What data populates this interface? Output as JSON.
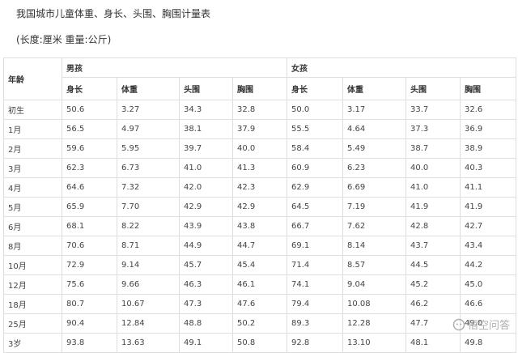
{
  "title": "我国城市儿童体重、身长、头围、胸围计量表",
  "subtitle": "(长度:厘米 重量:公斤)",
  "table": {
    "age_header": "年龄",
    "boys_header": "男孩",
    "girls_header": "女孩",
    "sub_headers": [
      "身长",
      "体重",
      "头围",
      "胸围",
      "身长",
      "体重",
      "头围",
      "胸围"
    ],
    "rows": [
      [
        "初生",
        "50.6",
        "3.27",
        "34.3",
        "32.8",
        "50.0",
        "3.17",
        "33.7",
        "32.6"
      ],
      [
        "1月",
        "56.5",
        "4.97",
        "38.1",
        "37.9",
        "55.5",
        "4.64",
        "37.3",
        "36.9"
      ],
      [
        "2月",
        "59.6",
        "5.95",
        "39.7",
        "40.0",
        "58.4",
        "5.49",
        "38.7",
        "38.9"
      ],
      [
        "3月",
        "62.3",
        "6.73",
        "41.0",
        "41.3",
        "60.9",
        "6.23",
        "40.0",
        "40.3"
      ],
      [
        "4月",
        "64.6",
        "7.32",
        "42.0",
        "42.3",
        "62.9",
        "6.69",
        "41.0",
        "41.1"
      ],
      [
        "5月",
        "65.9",
        "7.70",
        "42.9",
        "42.9",
        "64.5",
        "7.19",
        "41.9",
        "41.9"
      ],
      [
        "6月",
        "68.1",
        "8.22",
        "43.9",
        "43.8",
        "66.7",
        "7.62",
        "42.8",
        "42.7"
      ],
      [
        "8月",
        "70.6",
        "8.71",
        "44.9",
        "44.7",
        "69.1",
        "8.14",
        "43.7",
        "43.4"
      ],
      [
        "10月",
        "72.9",
        "9.14",
        "45.7",
        "45.4",
        "71.4",
        "8.57",
        "44.5",
        "44.2"
      ],
      [
        "12月",
        "75.6",
        "9.66",
        "46.3",
        "46.1",
        "74.1",
        "9.04",
        "45.2",
        "45.0"
      ],
      [
        "18月",
        "80.7",
        "10.67",
        "47.3",
        "47.6",
        "79.4",
        "10.08",
        "46.2",
        "46.6"
      ],
      [
        "25月",
        "90.4",
        "12.84",
        "48.8",
        "50.2",
        "89.3",
        "12.28",
        "47.7",
        "49.0"
      ],
      [
        "3岁",
        "93.8",
        "13.63",
        "49.1",
        "50.8",
        "92.8",
        "13.10",
        "48.1",
        "49.8"
      ]
    ]
  },
  "watermark": {
    "text": "悟空问答",
    "icon": "wukong-logo-icon"
  }
}
